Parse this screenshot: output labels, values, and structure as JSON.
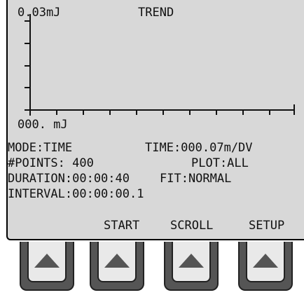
{
  "screen": {
    "title": "TREND",
    "plot": {
      "y_top_label": "0.03mJ",
      "x_bottom_label": "000. mJ"
    },
    "status": {
      "mode": "MODE:TIME",
      "time": "TIME:000.07m/DV",
      "points": "#POINTS: 400",
      "plot": "PLOT:ALL",
      "duration": "DURATION:00:00:40",
      "fit": "FIT:NORMAL",
      "interval": "INTERVAL:00:00:00.1"
    },
    "softkeys": [
      "",
      "START",
      "SCROLL",
      "SETUP"
    ]
  },
  "hard_buttons": [
    {
      "icon": "up-triangle-icon"
    },
    {
      "icon": "up-triangle-icon"
    },
    {
      "icon": "up-triangle-icon"
    },
    {
      "icon": "up-triangle-icon"
    }
  ],
  "colors": {
    "lcd_background": "#d8d8d8",
    "lcd_text": "#111111",
    "button_body": "#555555",
    "button_face": "#e9e9e9"
  }
}
